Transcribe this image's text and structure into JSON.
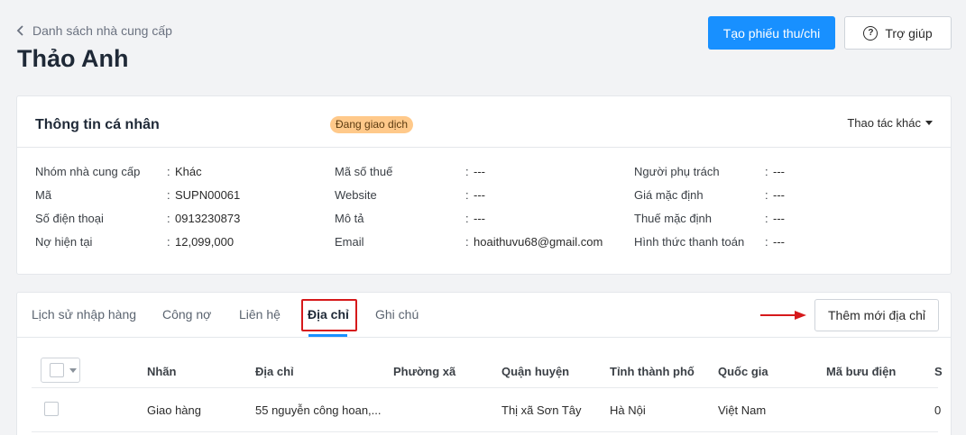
{
  "breadcrumb": {
    "label": "Danh sách nhà cung cấp"
  },
  "page_title": "Thảo Anh",
  "actions": {
    "create_receipt": "Tạo phiếu thu/chi",
    "help": "Trợ giúp"
  },
  "profile": {
    "title": "Thông tin cá nhân",
    "status": "Đang giao dịch",
    "more_actions": "Thao tác khác",
    "col1": [
      {
        "label": "Nhóm nhà cung cấp",
        "value": "Khác"
      },
      {
        "label": "Mã",
        "value": "SUPN00061"
      },
      {
        "label": "Số điện thoại",
        "value": "0913230873"
      },
      {
        "label": "Nợ hiện tại",
        "value": "12,099,000"
      }
    ],
    "col2": [
      {
        "label": "Mã số thuế",
        "value": "---"
      },
      {
        "label": "Website",
        "value": "---"
      },
      {
        "label": "Mô tả",
        "value": "---"
      },
      {
        "label": "Email",
        "value": "hoaithuvu68@gmail.com"
      }
    ],
    "col3": [
      {
        "label": "Người phụ trách",
        "value": "---"
      },
      {
        "label": "Giá mặc định",
        "value": "---"
      },
      {
        "label": "Thuế mặc định",
        "value": "---"
      },
      {
        "label": "Hình thức thanh toán",
        "value": "---"
      }
    ]
  },
  "tabs": [
    "Lịch sử nhập hàng",
    "Công nợ",
    "Liên hệ",
    "Địa chỉ",
    "Ghi chú"
  ],
  "active_tab": "Địa chỉ",
  "add_address": "Thêm mới địa chỉ",
  "table": {
    "headers": [
      "Nhãn",
      "Địa chỉ",
      "Phường xã",
      "Quận huyện",
      "Tỉnh thành phố",
      "Quốc gia",
      "Mã bưu điện",
      "S"
    ],
    "rows": [
      [
        "Giao hàng",
        "55 nguyễn công hoan,...",
        "",
        "Thị xã Sơn Tây",
        "Hà Nội",
        "Việt Nam",
        "",
        "0"
      ]
    ]
  },
  "colors": {
    "primary": "#1890ff",
    "badge": "#ffc98a",
    "highlight": "#d6191b"
  }
}
